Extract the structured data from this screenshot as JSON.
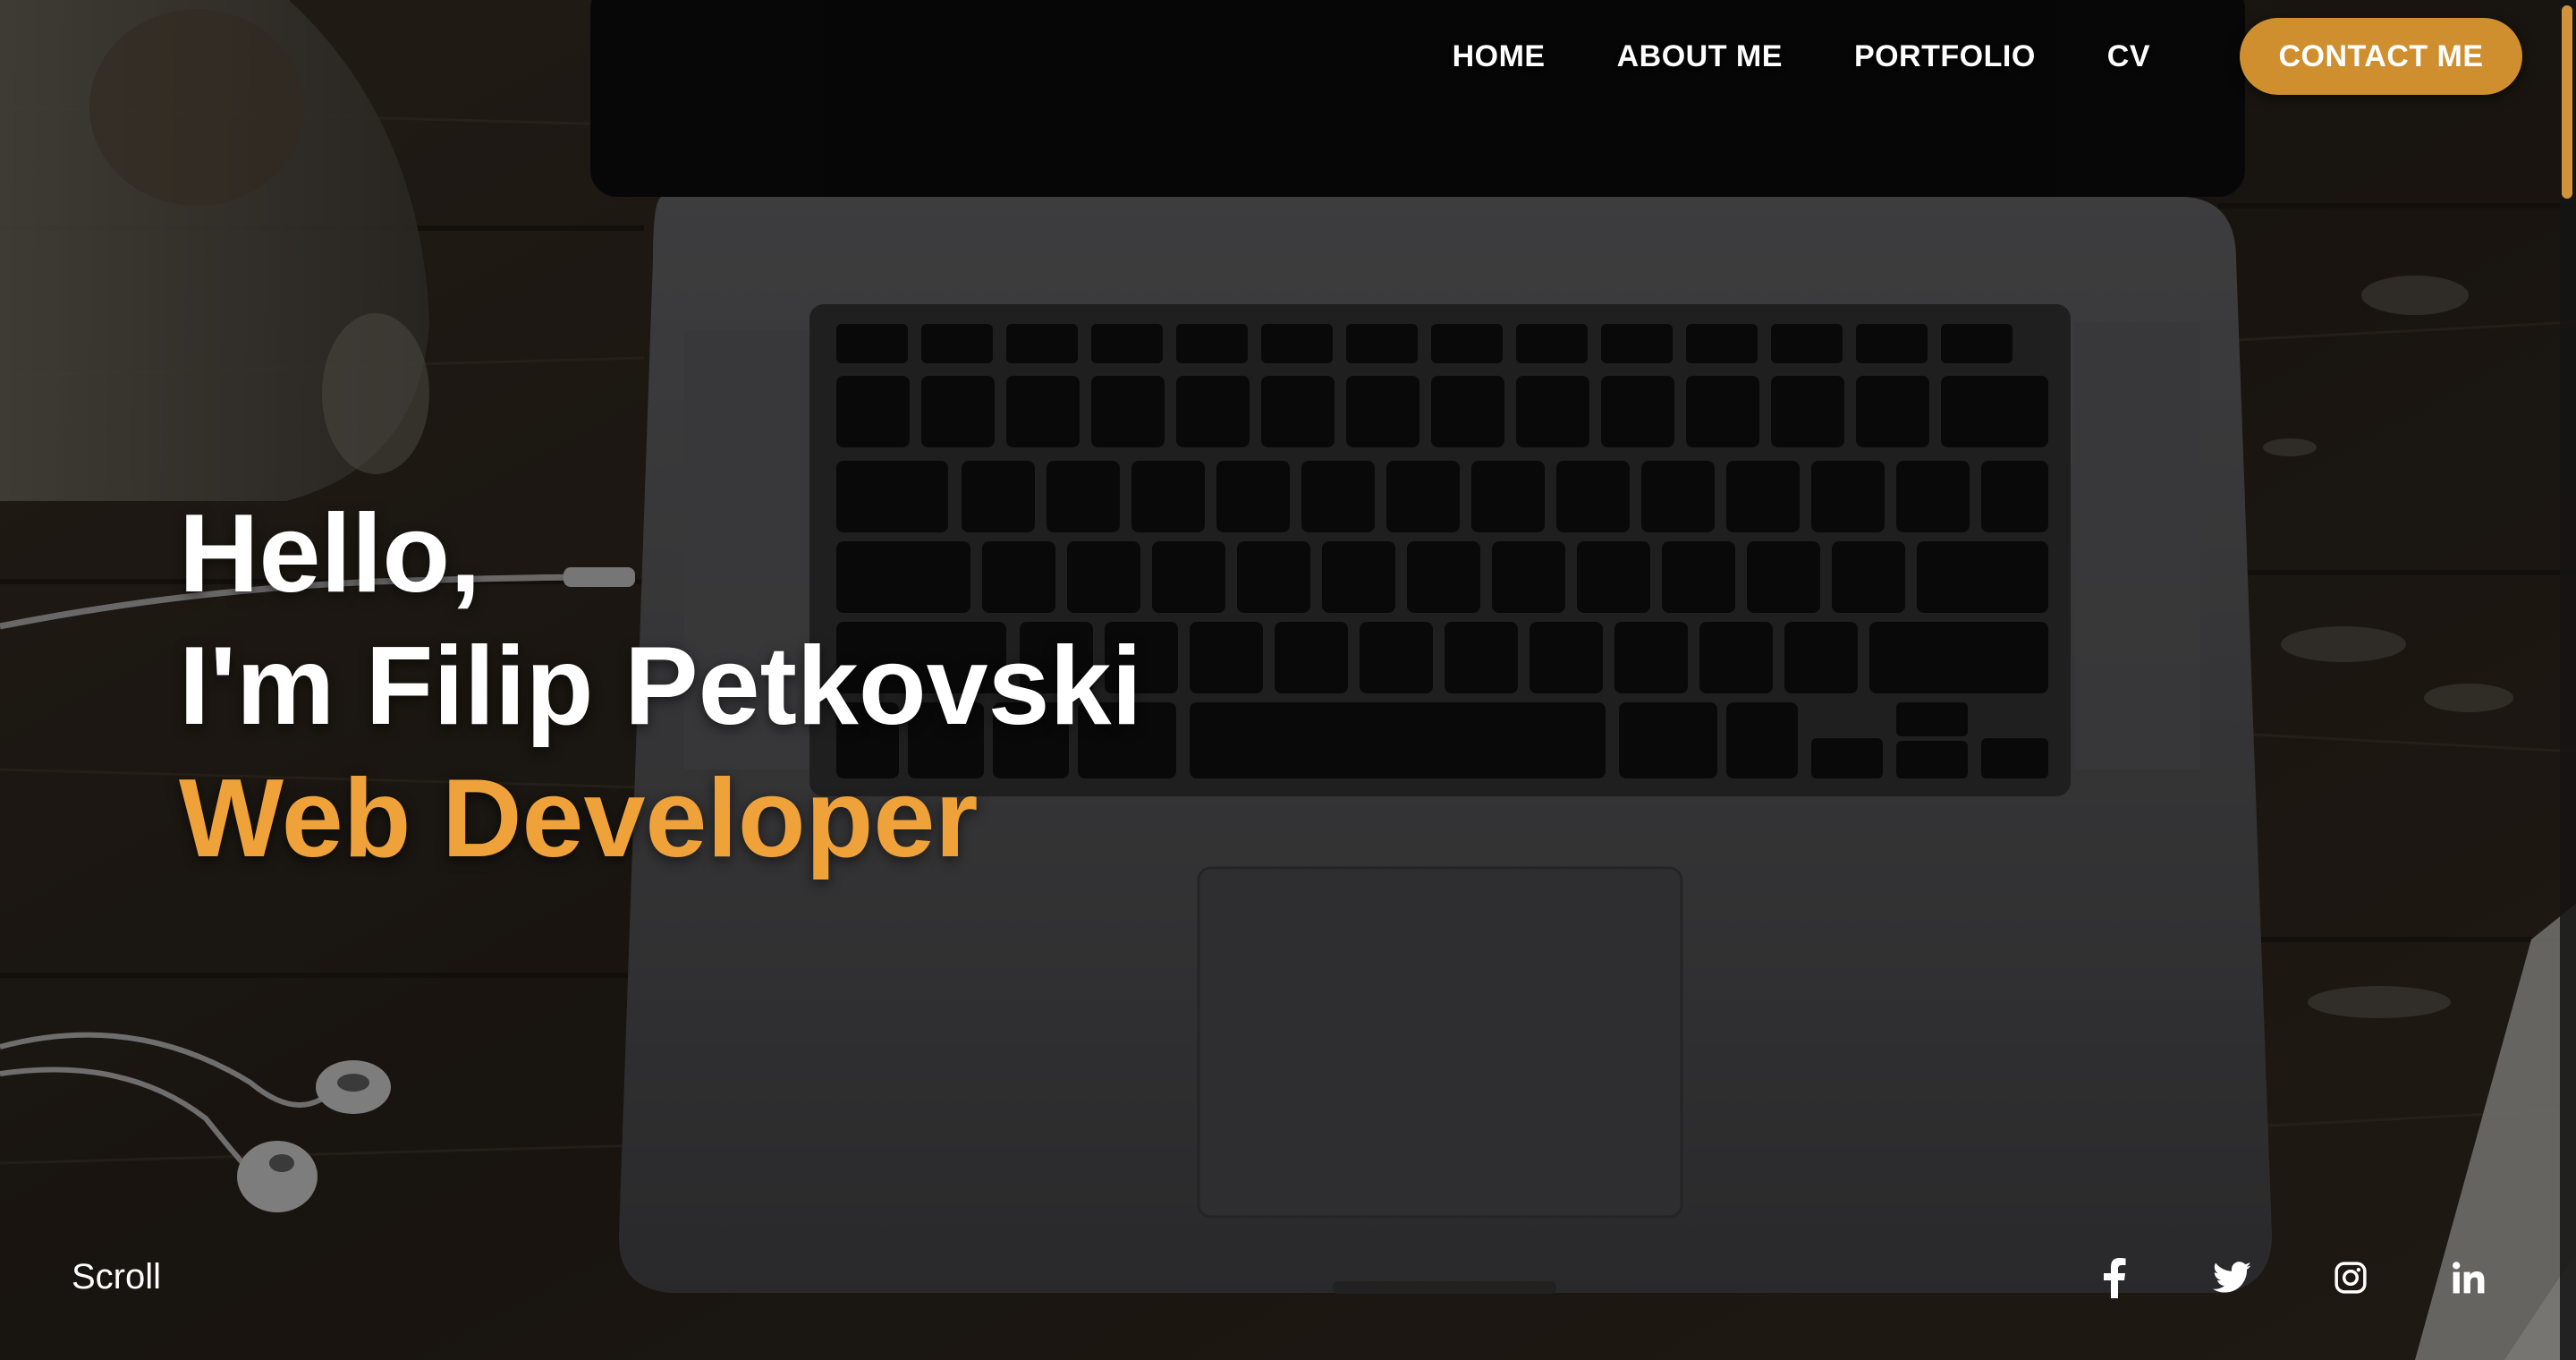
{
  "nav": {
    "items": [
      {
        "label": "HOME"
      },
      {
        "label": "ABOUT ME"
      },
      {
        "label": "PORTFOLIO"
      },
      {
        "label": "CV"
      }
    ],
    "contact_label": "CONTACT ME"
  },
  "hero": {
    "greeting": "Hello,",
    "name_line": "I'm Filip Petkovski",
    "role": "Web Developer"
  },
  "footer": {
    "scroll_label": "Scroll",
    "social": [
      {
        "icon": "facebook-icon"
      },
      {
        "icon": "twitter-icon"
      },
      {
        "icon": "instagram-icon"
      },
      {
        "icon": "linkedin-icon"
      }
    ]
  },
  "colors": {
    "accent": "#f0a23a",
    "button": "#cf8f2e",
    "text": "#ffffff"
  }
}
